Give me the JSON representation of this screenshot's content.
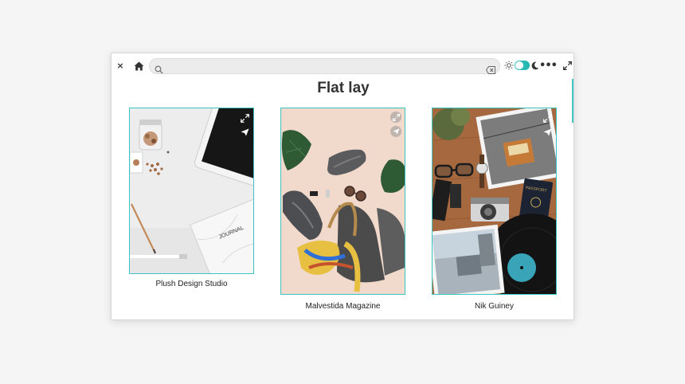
{
  "toolbar": {
    "close_glyph": "×",
    "url_value": "",
    "url_placeholder": "",
    "more_glyph": "•••",
    "theme_toggle_on": true
  },
  "page": {
    "title": "Flat lay"
  },
  "gallery": [
    {
      "caption": "Plush Design Studio",
      "photo": "desk flat lay with tablet, pencil, journal and stationery",
      "journal_text": "JOURNAL"
    },
    {
      "caption": "Malvestida Magazine",
      "photo": "flat lay with grey sneakers, sunglasses, leaf, bag and scarf on pink"
    },
    {
      "caption": "Nik Guiney",
      "photo": "travel flat lay with glasses, camera, passport, vinyl record and photos on wood",
      "passport_text": "PASSPORT"
    }
  ],
  "icons": {
    "close": "close-icon",
    "home": "home-icon",
    "search": "search-icon",
    "clear": "clear-icon",
    "sun": "sun-icon",
    "moon": "moon-icon",
    "more": "more-icon",
    "expand": "expand-icon",
    "photo_expand": "expand-icon",
    "photo_send": "send-icon"
  },
  "colors": {
    "accent": "#3cc4c0",
    "title": "#333333",
    "background": "#f5f5f5"
  }
}
